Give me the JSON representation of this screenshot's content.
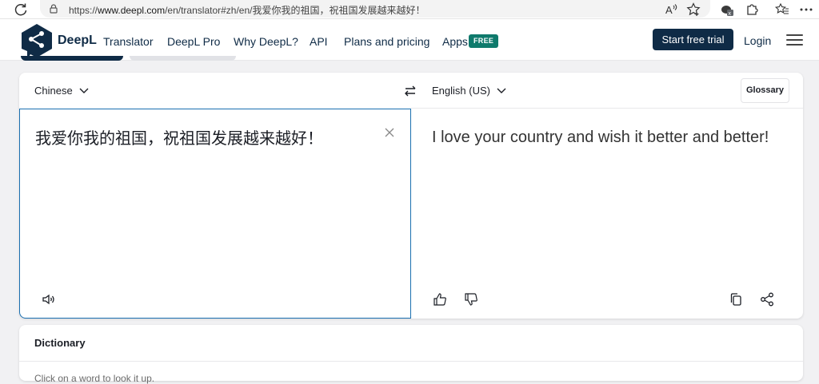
{
  "browser": {
    "url_prefix": "https://",
    "url_host": "www.deepl.com",
    "url_rest": "/en/translator#zh/en/我爱你我的祖国，祝祖国发展越来越好！"
  },
  "header": {
    "brand": "DeepL",
    "brand_sub": "Translator",
    "nav": [
      "DeepL Pro",
      "Why DeepL?",
      "API",
      "Plans and pricing",
      "Apps"
    ],
    "apps_badge": "FREE",
    "trial_button": "Start free trial",
    "login": "Login"
  },
  "translator": {
    "source_lang": "Chinese",
    "target_lang": "English (US)",
    "glossary": "Glossary",
    "source_text": "我爱你我的祖国，祝祖国发展越来越好！",
    "target_text": "I love your country and wish it better and better!"
  },
  "dictionary": {
    "title": "Dictionary",
    "hint": "Click on a word to look it up."
  },
  "colors": {
    "brand_navy": "#0f2b46",
    "badge_green": "#0f7a6c",
    "focus_blue": "#1a6fb0"
  }
}
